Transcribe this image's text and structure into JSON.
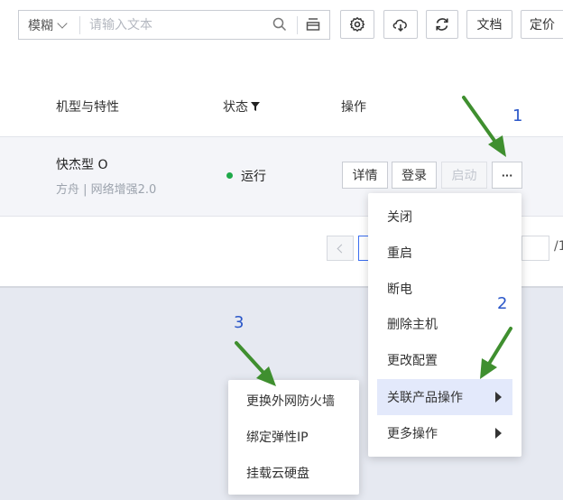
{
  "toolbar": {
    "search_mode": "模糊",
    "search_placeholder": "请输入文本",
    "docs_label": "文档",
    "pricing_label": "定价"
  },
  "table": {
    "headers": [
      "机型与特性",
      "状态",
      "操作"
    ],
    "row": {
      "name": "快杰型 O",
      "sub": "方舟 | 网络增强2.0",
      "status": "运行",
      "actions": [
        "详情",
        "登录",
        "启动",
        "···"
      ]
    }
  },
  "pagination": {
    "total_prefix": "/1"
  },
  "dropdown_menu": [
    "关闭",
    "重启",
    "断电",
    "删除主机",
    "更改配置",
    "关联产品操作",
    "更多操作"
  ],
  "submenu": [
    "更换外网防火墙",
    "绑定弹性IP",
    "挂载云硬盘"
  ],
  "annotations": [
    "1",
    "2",
    "3"
  ],
  "colors": {
    "accent": "#2b57c9",
    "running": "#1ea94a",
    "arrow": "#3f8f2f"
  }
}
